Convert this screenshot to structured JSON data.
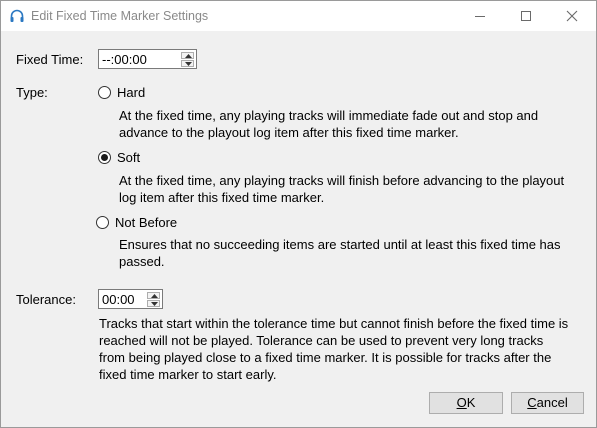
{
  "window": {
    "title": "Edit Fixed Time Marker Settings"
  },
  "fixed_time": {
    "label": "Fixed Time:",
    "value": "--:00:00"
  },
  "type": {
    "label": "Type:",
    "options": [
      {
        "label": "Hard",
        "checked": false,
        "description_lines": [
          "At the fixed time, any playing tracks will immediate fade out and stop and",
          "advance to the playout log item after this fixed time marker."
        ]
      },
      {
        "label": "Soft",
        "checked": true,
        "description_lines": [
          "At the fixed time, any playing tracks will finish before advancing to the playout",
          "log item after this fixed time marker."
        ]
      },
      {
        "label": "Not Before",
        "checked": false,
        "description_lines": [
          "Ensures that no succeeding items are started until at least this fixed time has",
          "passed."
        ]
      }
    ]
  },
  "tolerance": {
    "label": "Tolerance:",
    "value": "00:00",
    "description_lines": [
      "Tracks that start within the tolerance time but cannot finish before the fixed time is",
      "reached will not be played. Tolerance can be used to prevent very long tracks",
      "from being played close to a fixed time marker. It is possible for tracks after the",
      "fixed time marker to start early."
    ]
  },
  "buttons": {
    "ok": {
      "accel": "O",
      "rest": "K"
    },
    "cancel": {
      "accel": "C",
      "rest": "ancel"
    }
  },
  "icons": {
    "app": "headphones-icon",
    "minimize": "minimize-icon",
    "maximize": "maximize-icon",
    "close": "close-icon",
    "spin_up": "spin-up-arrow-icon",
    "spin_down": "spin-down-arrow-icon"
  },
  "colors": {
    "accent": "#2b78c2",
    "title_text": "#8a8a8a"
  }
}
